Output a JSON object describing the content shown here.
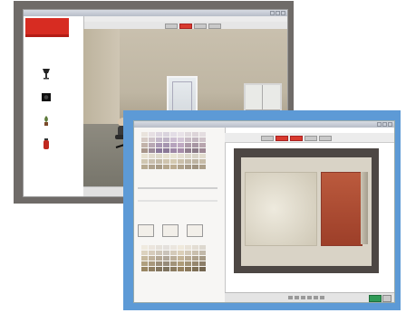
{
  "back_window": {
    "brand_label": "",
    "title": "",
    "menu": [
      "",
      "",
      "",
      "",
      "",
      ""
    ],
    "catalog_items": [
      {
        "label": "",
        "icon": "lamp-icon",
        "color": "#222222"
      },
      {
        "label": "",
        "icon": "speaker-icon",
        "color": "#111111"
      },
      {
        "label": "",
        "icon": "plant-icon",
        "color": "#7b4a2a"
      },
      {
        "label": "",
        "icon": "fire-extinguisher-icon",
        "color": "#c0281f"
      }
    ],
    "accent_color": "#d72c22"
  },
  "front_window": {
    "title": "",
    "section_heading": "",
    "chip_labels": [
      "",
      "",
      ""
    ],
    "swatches_top": [
      "#e9e3dc",
      "#e6dfe3",
      "#ddd6e0",
      "#d9d3dd",
      "#e3dde6",
      "#e8e2e8",
      "#e0d9dd",
      "#dcd4d8",
      "#e4dde0",
      "#d6cbc5",
      "#cfc4ca",
      "#c3b8c9",
      "#bfb4c6",
      "#cdbfd2",
      "#d3c6d6",
      "#c8bbc5",
      "#c2b6bf",
      "#cfc3c9",
      "#c2b3aa",
      "#b7a7b3",
      "#a897b3",
      "#a595b0",
      "#b6a3bd",
      "#bea8c1",
      "#ad9aa9",
      "#a796a3",
      "#b8a5ae",
      "#a8968b",
      "#9b8a98",
      "#8b799a",
      "#8a7896",
      "#9d87a6",
      "#a68ca9",
      "#907d8e",
      "#8a7a87",
      "#9e8894",
      "#e8e2d2",
      "#e2dccf",
      "#dfdacb",
      "#e6e0cf",
      "#e8e4d4",
      "#e4ded1",
      "#ddd8cb",
      "#d9d4c8",
      "#e1dbcd",
      "#d0c7b2",
      "#c9bfae",
      "#c4baa7",
      "#cfc4ae",
      "#d4c9b1",
      "#cbc0ab",
      "#c2b8a6",
      "#beb4a2",
      "#c7bca8",
      "#b8ab92",
      "#afa28d",
      "#a89b86",
      "#b5a68d",
      "#bcac91",
      "#b0a28b",
      "#a69986",
      "#a09380",
      "#ac9f89"
    ],
    "swatches_bottom": [
      "#efeadf",
      "#ebe5dd",
      "#e6e1da",
      "#e4e0dc",
      "#ebe6de",
      "#efe9dc",
      "#e9e3d8",
      "#e3ddd3",
      "#ddd8cf",
      "#dcd2bf",
      "#d6cbbb",
      "#cec5b7",
      "#cac3ba",
      "#d4cab9",
      "#dbcfb8",
      "#d2c8b6",
      "#c9bfae",
      "#c2b9aa",
      "#c7b99e",
      "#bfb19b",
      "#b5a895",
      "#b0a698",
      "#bbae99",
      "#c4b497",
      "#b9ab94",
      "#ada08b",
      "#a59985",
      "#b0a07f",
      "#a7977c",
      "#9b8d78",
      "#968b7a",
      "#a29379",
      "#ad9b78",
      "#a29275",
      "#95866e",
      "#8c7e68",
      "#998663",
      "#8f7e62",
      "#83755f",
      "#7e735f",
      "#8b7b60",
      "#968260",
      "#8b795c",
      "#7e6f56",
      "#746650"
    ],
    "wall_left_color": "#e9e4d7",
    "wall_right_color": "#b24f35",
    "frame_color": "#5d9ad6"
  }
}
